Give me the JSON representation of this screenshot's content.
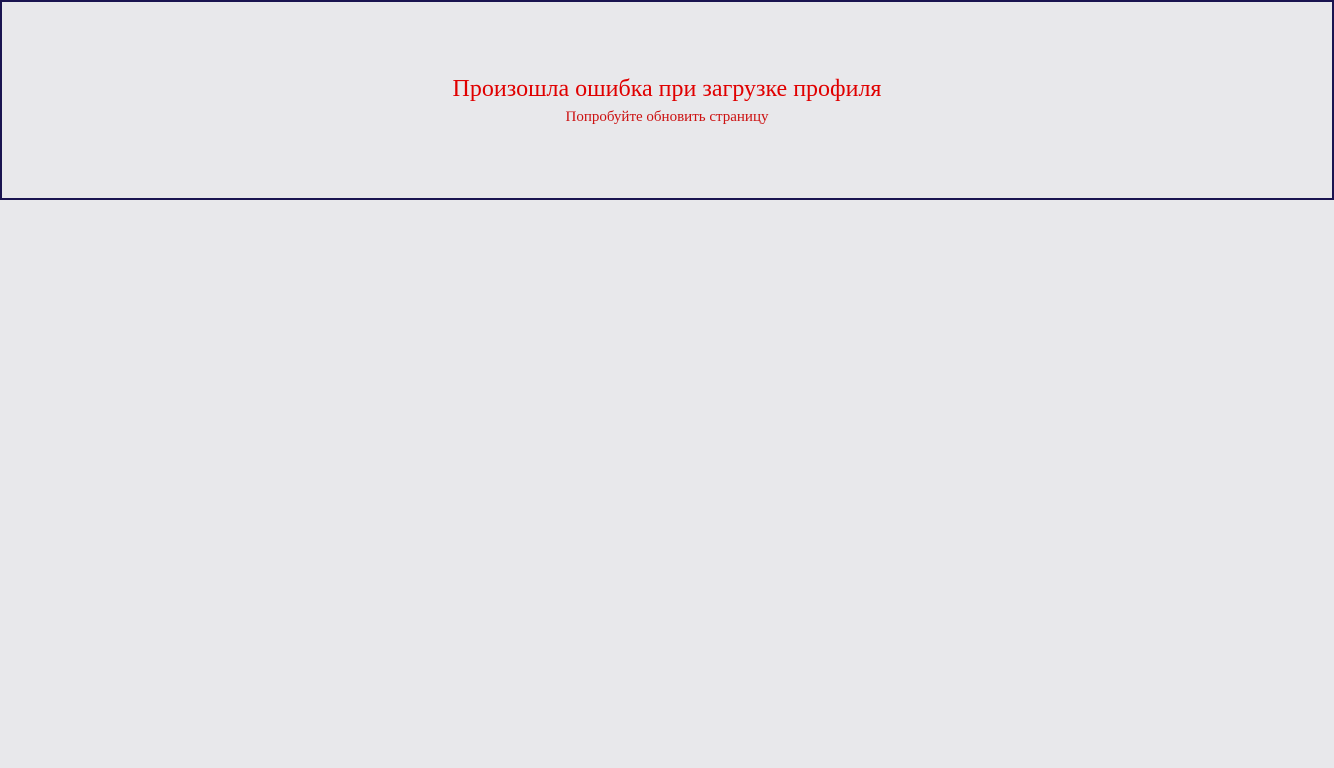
{
  "error": {
    "title": "Произошла ошибка при загрузке профиля",
    "subtitle": "Попробуйте обновить страницу"
  },
  "colors": {
    "background": "#e8e8eb",
    "panel_border": "#1a1450",
    "error_text": "#e00000"
  }
}
